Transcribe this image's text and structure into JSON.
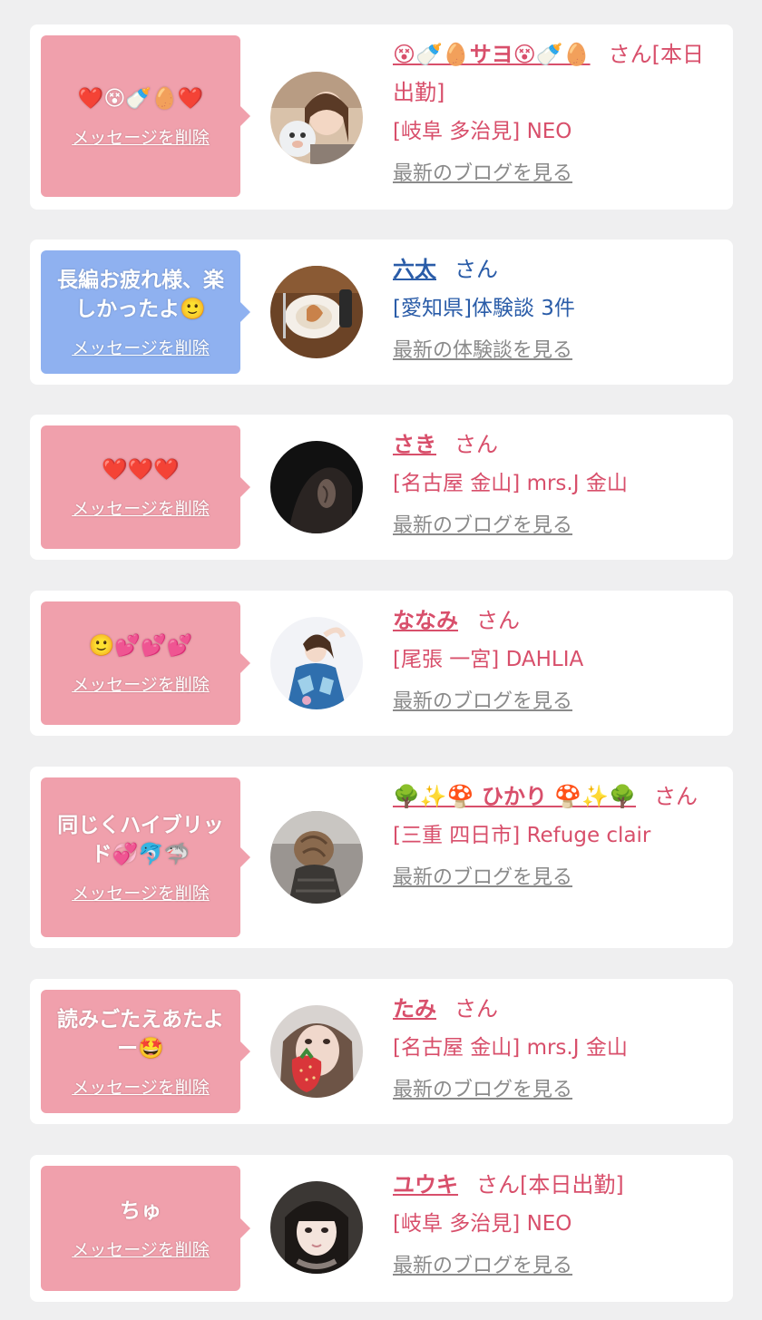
{
  "delete_label": "メッセージを削除",
  "colors": {
    "cast_pink_bubble": "#f0a0ac",
    "customer_blue_bubble": "#8fb1f0",
    "cast_text": "#d84f6b",
    "customer_text": "#2a5ca8",
    "link_gray": "#8a8a8a",
    "page_background": "#efeff0"
  },
  "cards": [
    {
      "type": "cast",
      "bubble_color": "pink",
      "message": "❤️😵🍼🥚❤️",
      "name": "😵🍼🥚サヨ😵🍼🥚",
      "suffix": "さん[本日出勤]",
      "shop": "[岐阜 多治見] NEO",
      "link": "最新のブログを見る",
      "avatar": "woman-with-plush-toy"
    },
    {
      "type": "customer",
      "bubble_color": "blue",
      "message": "長編お疲れ様、楽しかったよ🙂",
      "name": "六太",
      "suffix": "さん",
      "shop": "[愛知県]体験談 3件",
      "link": "最新の体験談を見る",
      "avatar": "dinner-plate"
    },
    {
      "type": "cast",
      "bubble_color": "pink",
      "message": "❤️❤️❤️",
      "name": "さき",
      "suffix": "さん",
      "shop": "[名古屋 金山] mrs.J 金山",
      "link": "最新のブログを見る",
      "avatar": "dark-profile"
    },
    {
      "type": "cast",
      "bubble_color": "pink",
      "message": "🙂💕💕💕",
      "name": "ななみ",
      "suffix": "さん",
      "shop": "[尾張 一宮] DAHLIA",
      "link": "最新のブログを見る",
      "avatar": "woman-in-kimono"
    },
    {
      "type": "cast",
      "bubble_color": "pink",
      "message": "同じくハイブリッド💞🐬🦈",
      "name": "🌳✨🍄 ひかり 🍄✨🌳",
      "suffix": "さん",
      "shop": "[三重 四日市] Refuge clair",
      "link": "最新のブログを見る",
      "avatar": "hair-bun"
    },
    {
      "type": "cast",
      "bubble_color": "pink",
      "message": "読みごたえあたよー🤩",
      "name": "たみ",
      "suffix": "さん",
      "shop": "[名古屋 金山] mrs.J 金山",
      "link": "最新のブログを見る",
      "avatar": "woman-with-strawberry"
    },
    {
      "type": "cast",
      "bubble_color": "pink",
      "message": "ちゅ",
      "name": "ユウキ",
      "suffix": "さん[本日出勤]",
      "shop": "[岐阜 多治見] NEO",
      "link": "最新のブログを見る",
      "avatar": "dark-hair-portrait"
    }
  ]
}
